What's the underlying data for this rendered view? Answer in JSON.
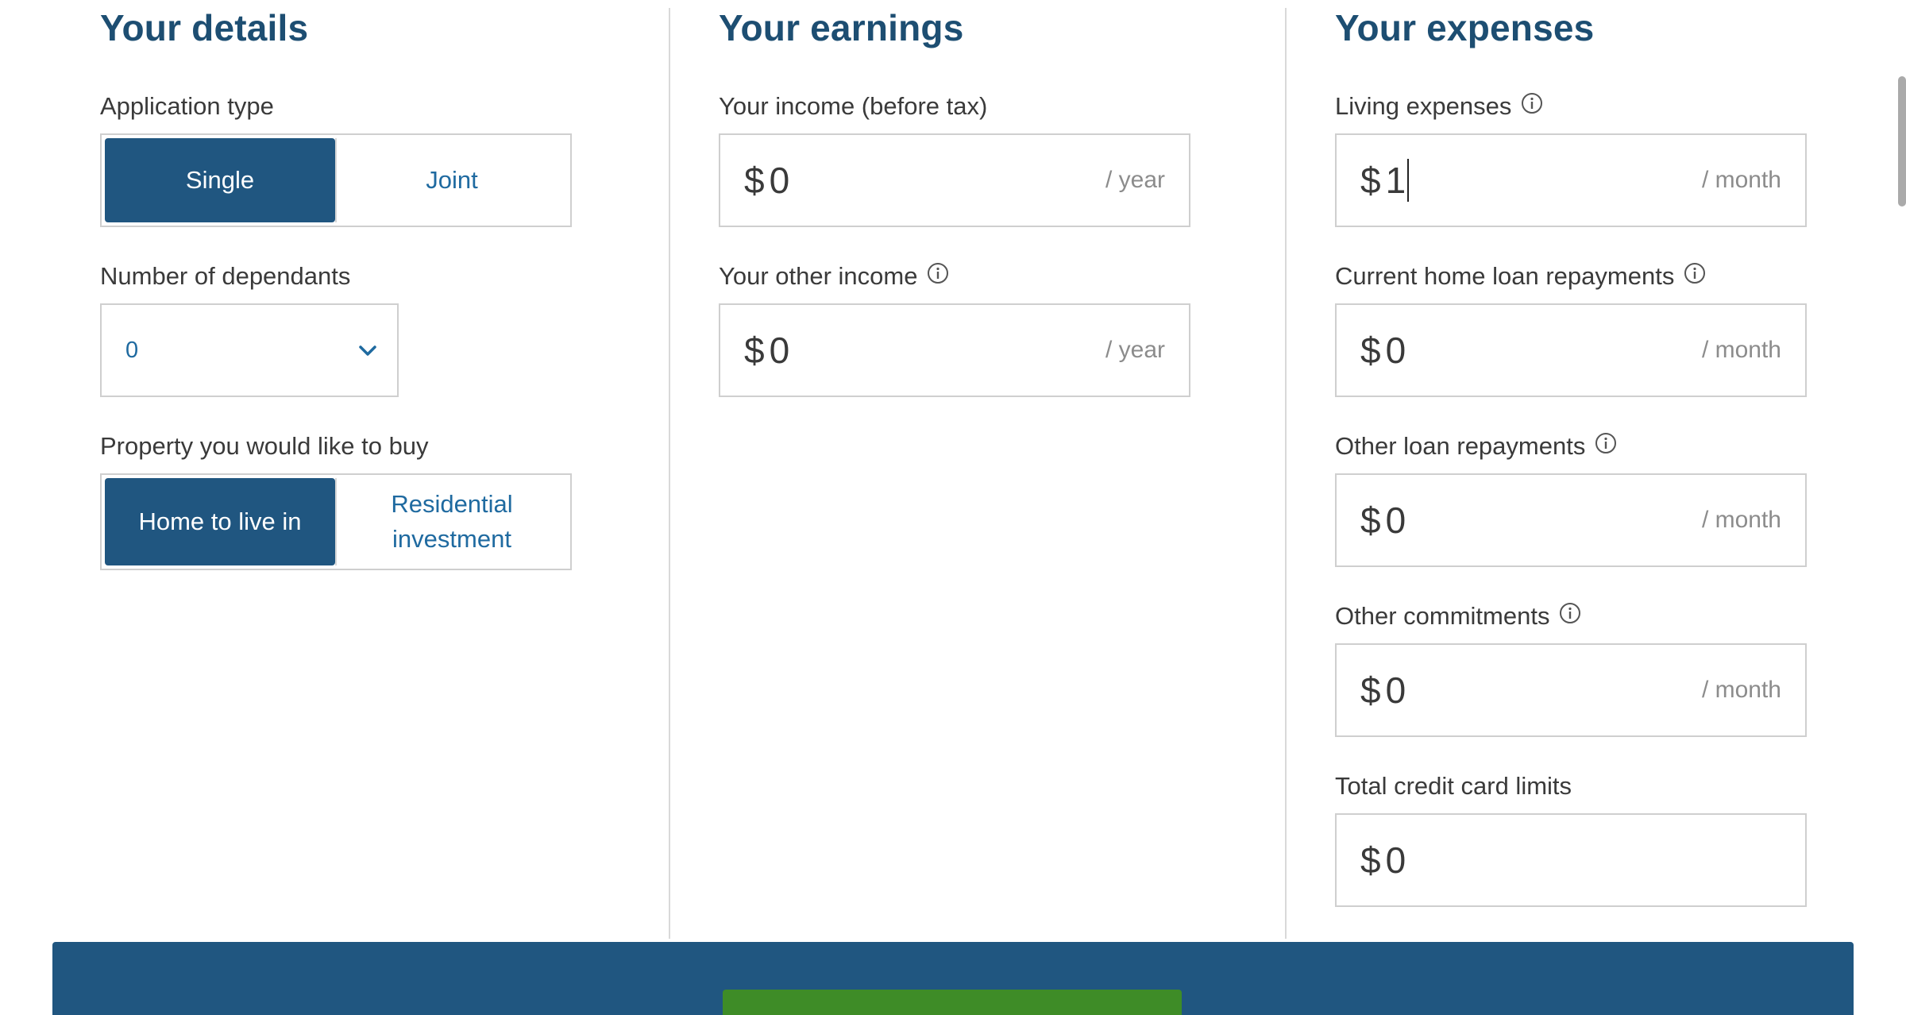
{
  "details": {
    "title": "Your details",
    "application_type": {
      "label": "Application type",
      "options": [
        "Single",
        "Joint"
      ],
      "selected": "Single"
    },
    "dependants": {
      "label": "Number of dependants",
      "value": "0"
    },
    "property": {
      "label": "Property you would like to buy",
      "options": [
        "Home to live in",
        "Residential investment"
      ],
      "option_lines": {
        "residential_1": "Residential",
        "residential_2": "investment"
      },
      "selected": "Home to live in"
    }
  },
  "earnings": {
    "title": "Your earnings",
    "income": {
      "label": "Your income (before tax)",
      "currency": "$",
      "value": "0",
      "unit": "/ year"
    },
    "other_income": {
      "label": "Your other income",
      "currency": "$",
      "value": "0",
      "unit": "/ year"
    }
  },
  "expenses": {
    "title": "Your expenses",
    "living": {
      "label": "Living expenses",
      "currency": "$",
      "value": "1",
      "unit": "/ month"
    },
    "home_loan": {
      "label": "Current home loan repayments",
      "currency": "$",
      "value": "0",
      "unit": "/ month"
    },
    "other_loan": {
      "label": "Other loan repayments",
      "currency": "$",
      "value": "0",
      "unit": "/ month"
    },
    "commitments": {
      "label": "Other commitments",
      "currency": "$",
      "value": "0",
      "unit": "/ month"
    },
    "credit_limits": {
      "label": "Total credit card limits",
      "currency": "$",
      "value": "0"
    }
  },
  "colors": {
    "heading": "#1d4e72",
    "toggle_active": "#205680",
    "link": "#1f6aa0",
    "cta": "#3e8c27",
    "band": "#205680"
  },
  "icons": {
    "info": "info-circle-icon",
    "chevron": "chevron-down-icon"
  }
}
